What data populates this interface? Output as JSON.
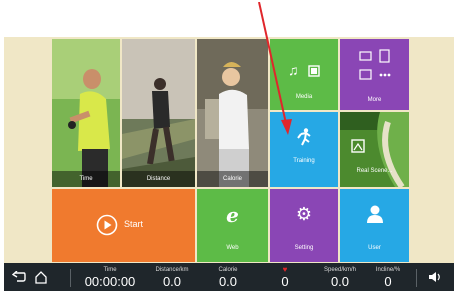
{
  "tiles": {
    "time": "Time",
    "distance": "Distance",
    "calorie": "Calorie",
    "media": "Media",
    "more": "More",
    "training": "Training",
    "real_scene": "Real Scene...",
    "start": "Start",
    "web": "Web",
    "setting": "Setting",
    "user": "User"
  },
  "status": {
    "time_label": "Time",
    "time_value": "00:00:00",
    "distance_label": "Distance/km",
    "distance_value": "0.0",
    "calorie_label": "Calorie",
    "calorie_value": "0.0",
    "heart_value": "0",
    "speed_label": "Speed/km/h",
    "speed_value": "0.0",
    "incline_label": "Incline/%",
    "incline_value": "0"
  },
  "colors": {
    "green": "#5dbb47",
    "purple": "#8a46b5",
    "blue": "#26a8e5",
    "orange": "#f07a2e",
    "annotation_arrow": "#e0262b"
  }
}
